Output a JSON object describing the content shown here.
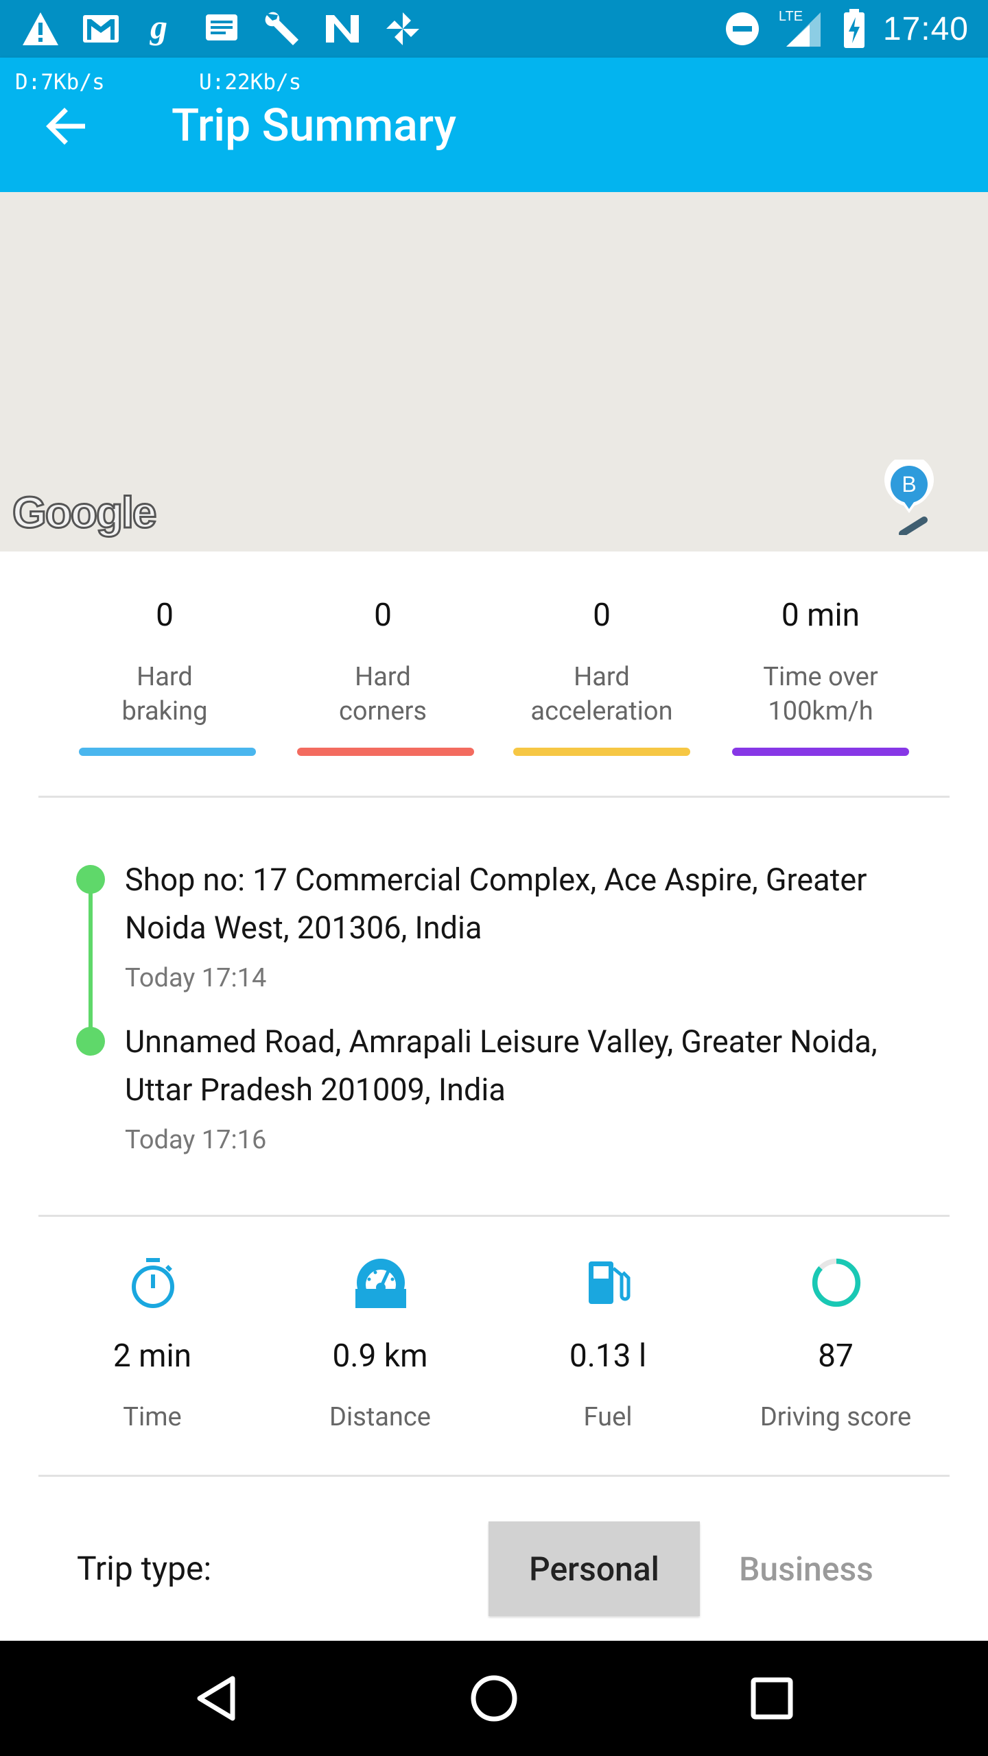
{
  "status_bar": {
    "time": "17:40",
    "network_label": "LTE",
    "left_icons": [
      "warning-icon",
      "gmail-icon",
      "g-app-icon",
      "message-icon",
      "wrench-icon",
      "n-app-icon",
      "pinwheel-icon"
    ],
    "right_icons": [
      "do-not-disturb-icon",
      "signal-icon",
      "battery-charging-icon"
    ]
  },
  "app_bar": {
    "download_speed": "D:7Kb/s",
    "upload_speed": "U:22Kb/s",
    "title": "Trip Summary"
  },
  "map": {
    "logo_text": "Google",
    "pin_label": "B"
  },
  "events": [
    {
      "value": "0",
      "label_line1": "Hard",
      "label_line2": "braking",
      "color": "#4ab6ee"
    },
    {
      "value": "0",
      "label_line1": "Hard",
      "label_line2": "corners",
      "color": "#f36b5f"
    },
    {
      "value": "0",
      "label_line1": "Hard",
      "label_line2": "acceleration",
      "color": "#f6c744"
    },
    {
      "value": "0 min",
      "label_line1": "Time over",
      "label_line2": "100km/h",
      "color": "#8737e6"
    }
  ],
  "route": {
    "start": {
      "address": "Shop no: 17 Commercial Complex, Ace Aspire, Greater Noida West, 201306, India",
      "time": "Today 17:14"
    },
    "end": {
      "address": "Unnamed Road, Amrapali Leisure Valley, Greater Noida, Uttar Pradesh 201009, India",
      "time": "Today 17:16"
    },
    "color": "#5fd86a"
  },
  "stats": [
    {
      "icon": "stopwatch-icon",
      "value": "2 min",
      "label": "Time"
    },
    {
      "icon": "speedometer-icon",
      "value": "0.9 km",
      "label": "Distance"
    },
    {
      "icon": "fuel-pump-icon",
      "value": "0.13 l",
      "label": "Fuel"
    },
    {
      "icon": "score-ring-icon",
      "value": "87",
      "label": "Driving score"
    }
  ],
  "trip_type": {
    "label": "Trip type:",
    "options": [
      "Personal",
      "Business"
    ],
    "selected": "Personal"
  },
  "nav_bar": {
    "buttons": [
      "back-nav-icon",
      "home-nav-icon",
      "recents-nav-icon"
    ]
  },
  "colors": {
    "status_bar": "#0290c4",
    "app_bar": "#03b4ef",
    "icon_accent": "#1aa7df"
  }
}
